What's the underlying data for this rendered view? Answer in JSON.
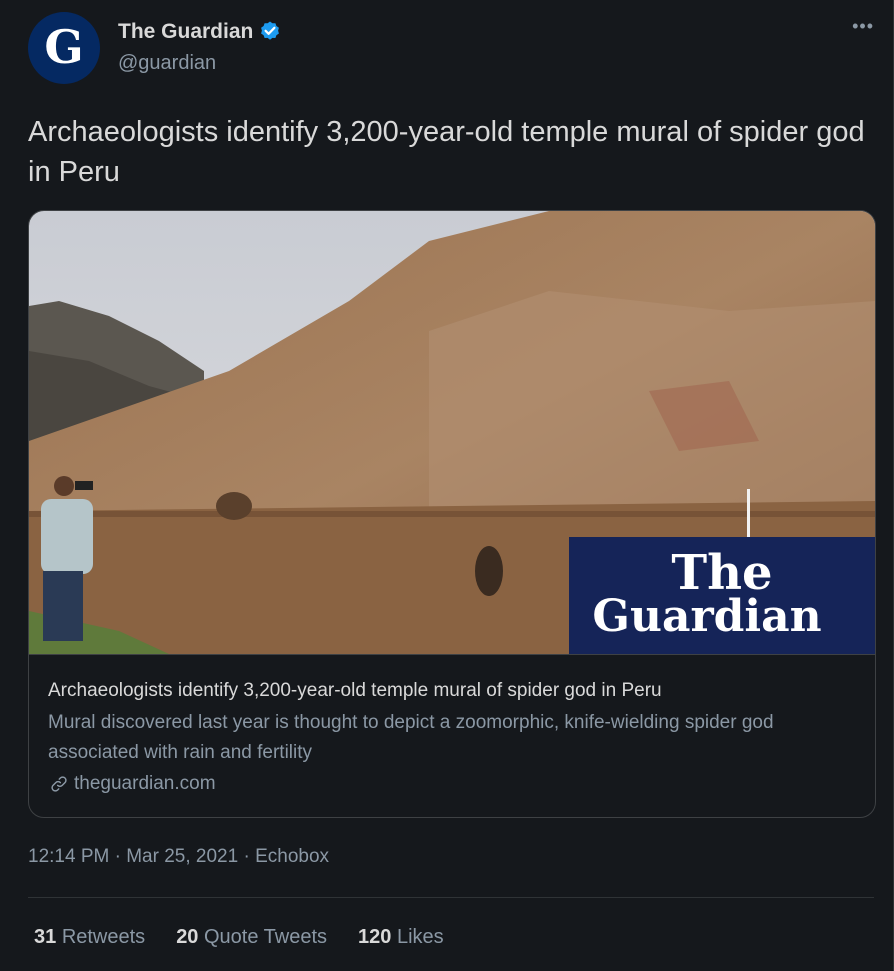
{
  "account": {
    "display_name": "The Guardian",
    "handle": "@guardian",
    "avatar_letter": "G",
    "avatar_color": "#052962",
    "verified_color": "#1d9bf0",
    "more_label": "•••"
  },
  "tweet": {
    "text": "Archaeologists identify 3,200-year-old temple mural of spider god in Peru"
  },
  "card": {
    "image_icon": "photo-of-man-photographing-adobe-temple-wall",
    "logo_line1": "The",
    "logo_line2": "Guardian",
    "logo_bg": "#152458",
    "title": "Archaeologists identify 3,200-year-old temple mural of spider god in Peru",
    "description": "Mural discovered last year is thought to depict a zoomorphic, knife-wielding spider god associated with rain and fertility",
    "domain": "theguardian.com"
  },
  "meta": {
    "time": "12:14 PM",
    "separator1": " · ",
    "date": "Mar 25, 2021",
    "separator2": " · ",
    "source": "Echobox"
  },
  "stats": {
    "retweets_count": "31",
    "retweets_label": "Retweets",
    "quote_count": "20",
    "quote_label": "Quote Tweets",
    "likes_count": "120",
    "likes_label": "Likes"
  }
}
